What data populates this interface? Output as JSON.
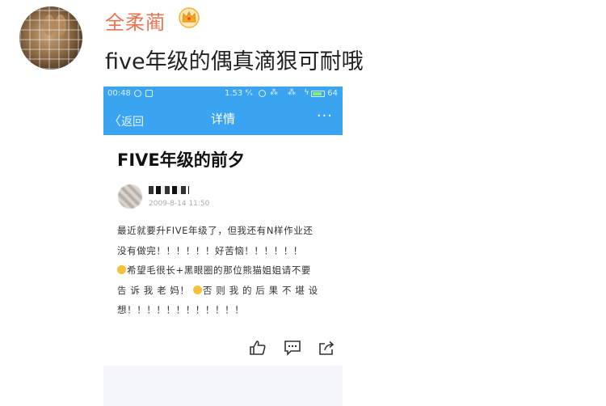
{
  "post": {
    "username": "全柔蔺",
    "text": "five年级的偶真滴狠可耐哦",
    "badge_icon": "crown-icon",
    "username_color": "#eb7350"
  },
  "screenshot": {
    "status": {
      "time": "00:48",
      "right_text": "1.53 ᴷ⁄ₛ",
      "battery": "64"
    },
    "nav": {
      "back_label": "返回",
      "title": "详情",
      "more_label": "···",
      "accent": "#3aa4f2"
    },
    "article": {
      "title": "FIVE年级的前夕",
      "date": "2009-8-14 11:50",
      "line1": "最近就要升FIVE年级了，但我还有N样作业还",
      "line2": "没有做完！！！！！！好苦恼！！！！！！",
      "line3": "希望毛很长+黑眼圈的那位熊猫姐姐请不要",
      "line4a": "告 诉 我 老 妈！",
      "line4b": "否 则 我 的 后 果 不 堪 设",
      "line5": "想！！！！！！！！！！！！"
    },
    "actions": [
      "like-icon",
      "comment-icon",
      "share-icon"
    ]
  }
}
